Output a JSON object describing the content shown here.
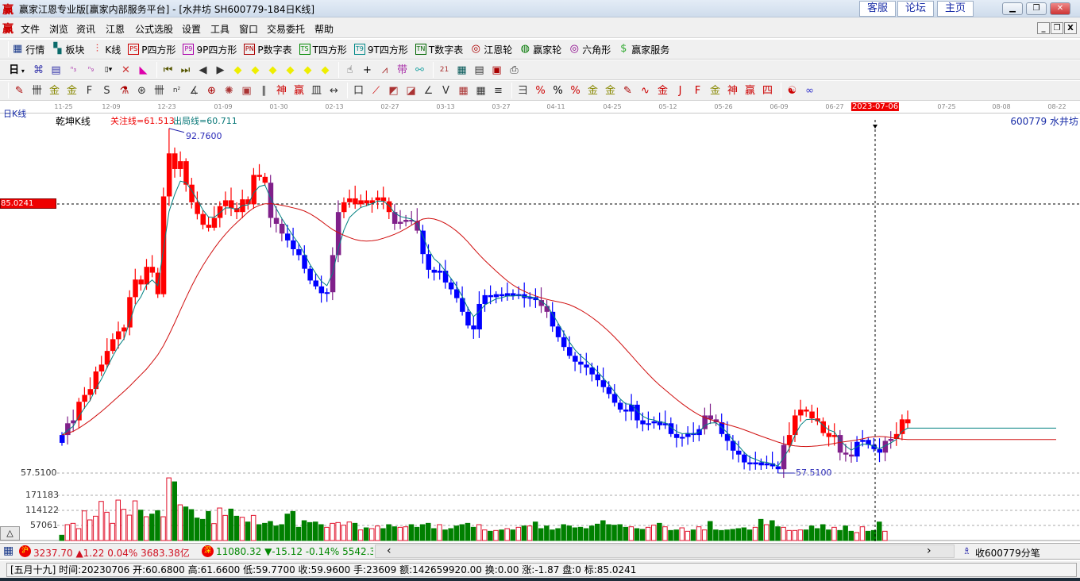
{
  "titlebar": {
    "title": "赢家江恩专业版[赢家内部服务平台] - [水井坊  SH600779-184日K线]",
    "links": [
      "客服",
      "论坛",
      "主页"
    ]
  },
  "menu": [
    "文件",
    "浏览",
    "资讯",
    "江恩",
    "公式选股",
    "设置",
    "工具",
    "窗口",
    "交易委托",
    "帮助"
  ],
  "toolbar1": [
    {
      "label": "行情",
      "icon": "grid-table-icon",
      "glyph": "▦",
      "color": "#1a3a8a"
    },
    {
      "label": "板块",
      "icon": "sector-blocks-icon",
      "glyph": "▚",
      "color": "#0a6a6a"
    },
    {
      "label": "K线",
      "icon": "candlestick-icon",
      "glyph": "⫶",
      "color": "#d00"
    },
    {
      "label": "P四方形",
      "icon": "ps-icon",
      "glyph": "PS",
      "color": "#c00"
    },
    {
      "label": "9P四方形",
      "icon": "p9-icon",
      "glyph": "P9",
      "color": "#a0a"
    },
    {
      "label": "P数字表",
      "icon": "pn-icon",
      "glyph": "PN",
      "color": "#a00"
    },
    {
      "label": "T四方形",
      "icon": "ts-icon",
      "glyph": "TS",
      "color": "#080"
    },
    {
      "label": "9T四方形",
      "icon": "t9-icon",
      "glyph": "T9",
      "color": "#088"
    },
    {
      "label": "T数字表",
      "icon": "tn-icon",
      "glyph": "TN",
      "color": "#060"
    },
    {
      "label": "江恩轮",
      "icon": "gann-wheel-icon",
      "glyph": "◎",
      "color": "#a00"
    },
    {
      "label": "赢家轮",
      "icon": "winner-wheel-icon",
      "glyph": "◍",
      "color": "#070"
    },
    {
      "label": "六角形",
      "icon": "hexagon-icon",
      "glyph": "◎",
      "color": "#808"
    },
    {
      "label": "赢家服务",
      "icon": "dollar-icon",
      "glyph": "$",
      "color": "#3a3"
    }
  ],
  "toolbar2": {
    "period": "日",
    "icons": [
      {
        "name": "cycle-icon",
        "glyph": "⌘",
        "color": "#33a"
      },
      {
        "name": "notes-icon",
        "glyph": "▤",
        "color": "#33a"
      },
      {
        "name": "indicator3-icon",
        "glyph": "ⁿ₃",
        "color": "#a3a"
      },
      {
        "name": "indicator9-icon",
        "glyph": "ⁿ₉",
        "color": "#a3a"
      },
      {
        "name": "candle-type-icon",
        "glyph": "▯▾",
        "color": "#000"
      },
      {
        "name": "restore-icon",
        "glyph": "✕",
        "color": "#c33"
      },
      {
        "name": "gradient-icon",
        "glyph": "◣",
        "color": "#d0a"
      },
      {
        "sep": true
      },
      {
        "name": "first-icon",
        "glyph": "⏮",
        "color": "#550"
      },
      {
        "name": "last-icon",
        "glyph": "⏭",
        "color": "#550"
      },
      {
        "name": "prev-icon",
        "glyph": "◀",
        "color": "#333"
      },
      {
        "name": "next-icon",
        "glyph": "▶",
        "color": "#333"
      },
      {
        "name": "left-arrow-diamond-icon",
        "glyph": "◆",
        "color": "#ee0"
      },
      {
        "name": "right-arrow-diamond-icon",
        "glyph": "◆",
        "color": "#ee0"
      },
      {
        "name": "expand-diamond-icon",
        "glyph": "◆",
        "color": "#ee0"
      },
      {
        "name": "shrink-diamond-icon",
        "glyph": "◆",
        "color": "#ee0"
      },
      {
        "name": "vexpand-diamond-icon",
        "glyph": "◆",
        "color": "#ee0"
      },
      {
        "name": "all-diamond-icon",
        "glyph": "◆",
        "color": "#ee0"
      },
      {
        "sep": true
      },
      {
        "name": "hand-icon",
        "glyph": "☝",
        "color": "#333"
      },
      {
        "name": "crosshair-icon",
        "glyph": "+",
        "color": "#000"
      },
      {
        "name": "zigzag-icon",
        "glyph": "⩘",
        "color": "#a33"
      },
      {
        "name": "pattern-icon",
        "glyph": "带",
        "color": "#a3a"
      },
      {
        "name": "chain-icon",
        "glyph": "⚯",
        "color": "#3aa"
      },
      {
        "sep": true
      },
      {
        "name": "calendar-icon",
        "glyph": "21",
        "color": "#a33"
      },
      {
        "name": "calculator-icon",
        "glyph": "▦",
        "color": "#055"
      },
      {
        "name": "report-icon",
        "glyph": "▤",
        "color": "#333"
      },
      {
        "name": "save-icon",
        "glyph": "▣",
        "color": "#a00"
      },
      {
        "name": "print-icon",
        "glyph": "⎙",
        "color": "#333"
      }
    ]
  },
  "toolbar3": [
    {
      "name": "pen-icon",
      "glyph": "✎",
      "color": "#a00"
    },
    {
      "name": "vlines-icon",
      "glyph": "卌",
      "color": "#333"
    },
    {
      "name": "gold-line-icon",
      "glyph": "金",
      "color": "#880"
    },
    {
      "name": "gold-line2-icon",
      "glyph": "金",
      "color": "#880"
    },
    {
      "name": "f-lines-icon",
      "glyph": "F",
      "color": "#333"
    },
    {
      "name": "spiral-icon",
      "glyph": "S",
      "color": "#333"
    },
    {
      "name": "rocket-icon",
      "glyph": "⚗",
      "color": "#a00"
    },
    {
      "name": "circle-ruler-icon",
      "glyph": "⊛",
      "color": "#333"
    },
    {
      "name": "period-lines-icon",
      "glyph": "卌",
      "color": "#333"
    },
    {
      "name": "n2-icon",
      "glyph": "n²",
      "color": "#333"
    },
    {
      "name": "angle-icon",
      "glyph": "∡",
      "color": "#333"
    },
    {
      "name": "target-icon",
      "glyph": "⊕",
      "color": "#a00"
    },
    {
      "name": "gann-star-icon",
      "glyph": "✺",
      "color": "#a33"
    },
    {
      "name": "square-target-icon",
      "glyph": "▣",
      "color": "#a33"
    },
    {
      "name": "parallel-icon",
      "glyph": "∥",
      "color": "#333"
    },
    {
      "name": "shen-icon",
      "glyph": "神",
      "color": "#c00"
    },
    {
      "name": "ying-icon",
      "glyph": "赢",
      "color": "#c00"
    },
    {
      "name": "comb-icon",
      "glyph": "皿",
      "color": "#333"
    },
    {
      "name": "width-icon",
      "glyph": "↔",
      "color": "#333"
    },
    {
      "sep": true
    },
    {
      "name": "box-icon",
      "glyph": "口",
      "color": "#333"
    },
    {
      "name": "fan-icon",
      "glyph": "⟋",
      "color": "#c00"
    },
    {
      "name": "arc-fan-icon",
      "glyph": "◩",
      "color": "#a33"
    },
    {
      "name": "box-fan-icon",
      "glyph": "◪",
      "color": "#a33"
    },
    {
      "name": "angle-fan-icon",
      "glyph": "∠",
      "color": "#333"
    },
    {
      "name": "v-icon",
      "glyph": "V",
      "color": "#333"
    },
    {
      "name": "grid-icon",
      "glyph": "▦",
      "color": "#a33"
    },
    {
      "name": "grid2-icon",
      "glyph": "▦",
      "color": "#333"
    },
    {
      "name": "slash-lines-icon",
      "glyph": "≡",
      "color": "#333"
    },
    {
      "sep": true
    },
    {
      "name": "ruler-icon",
      "glyph": "彐",
      "color": "#333"
    },
    {
      "name": "pct-line-icon",
      "glyph": "%",
      "color": "#c00"
    },
    {
      "name": "percent-icon",
      "glyph": "%",
      "color": "#000"
    },
    {
      "name": "pct-lines-icon",
      "glyph": "%",
      "color": "#c00"
    },
    {
      "name": "gold-circle-icon",
      "glyph": "金",
      "color": "#880"
    },
    {
      "name": "gold-lines-icon",
      "glyph": "金",
      "color": "#880"
    },
    {
      "name": "pen-lines-icon",
      "glyph": "✎",
      "color": "#a00"
    },
    {
      "name": "wave-icon",
      "glyph": "∿",
      "color": "#c00"
    },
    {
      "name": "gold-box-icon",
      "glyph": "金",
      "color": "#c00"
    },
    {
      "name": "j-fan-icon",
      "glyph": "J",
      "color": "#c00"
    },
    {
      "name": "f-fan-icon",
      "glyph": "F",
      "color": "#c00"
    },
    {
      "name": "gold-fan-icon",
      "glyph": "金",
      "color": "#880"
    },
    {
      "name": "shen-fan-icon",
      "glyph": "神",
      "color": "#c00"
    },
    {
      "name": "ying-fan-icon",
      "glyph": "赢",
      "color": "#c00"
    },
    {
      "name": "four-fan-icon",
      "glyph": "四",
      "color": "#c00"
    },
    {
      "sep": true
    },
    {
      "name": "taiji-icon",
      "glyph": "☯",
      "color": "#c00"
    },
    {
      "name": "infinity-icon",
      "glyph": "∞",
      "color": "#33c"
    }
  ],
  "chart_header": {
    "period_label": "日K线",
    "indicator": "乾坤K线",
    "focus_line": "关注线=61.513",
    "exit_line": "出局线=60.711",
    "symbol": "600779  水井坊",
    "high_label": "92.7600",
    "low_label": "-57.5100",
    "left_low": "57.5100",
    "cursor_price": "85.0241"
  },
  "date_ticks": [
    "11-25",
    "12-09",
    "12-23",
    "01-09",
    "01-30",
    "02-13",
    "02-27",
    "03-13",
    "03-27",
    "04-11",
    "04-25",
    "05-12",
    "05-26",
    "06-09",
    "06-27",
    "2023-07-06",
    "07-25",
    "08-08",
    "08-22"
  ],
  "colors": {
    "red": "#ff0000",
    "blue": "#0000ff",
    "purple": "#80208a",
    "ma_short": "#008080",
    "ma_long": "#d01010",
    "vol_up": "#e0102a",
    "vol_down": "#008000"
  },
  "chart_data": {
    "type": "candlestick",
    "ylim": [
      57.51,
      92.76
    ],
    "highest": 92.76,
    "lowest": 57.51,
    "close": [
      61.4,
      62.6,
      62.9,
      64.8,
      65.5,
      66.1,
      67.9,
      68.6,
      70.0,
      71.2,
      72.0,
      72.4,
      75.5,
      77.3,
      76.8,
      78.6,
      78.0,
      75.8,
      85.8,
      90.2,
      88.6,
      89.4,
      87.0,
      85.2,
      84.0,
      82.9,
      82.6,
      83.6,
      84.8,
      85.4,
      84.6,
      84.2,
      85.5,
      85.0,
      88.0,
      87.8,
      87.2,
      83.6,
      83.0,
      82.0,
      81.3,
      80.4,
      79.8,
      78.4,
      77.2,
      76.6,
      75.9,
      76.0,
      79.8,
      84.2,
      85.2,
      85.6,
      85.0,
      85.4,
      85.1,
      85.4,
      85.7,
      85.3,
      84.2,
      83.0,
      83.2,
      83.4,
      83.3,
      82.3,
      79.9,
      78.3,
      78.0,
      78.2,
      77.0,
      76.3,
      75.4,
      74.0,
      72.6,
      72.2,
      74.8,
      75.7,
      75.5,
      75.8,
      75.6,
      75.9,
      75.6,
      75.8,
      75.4,
      75.5,
      75.2,
      74.6,
      74.0,
      72.5,
      71.4,
      70.4,
      69.5,
      68.9,
      68.6,
      68.3,
      67.6,
      67.0,
      66.3,
      65.6,
      64.7,
      64.0,
      63.8,
      64.5,
      62.9,
      62.5,
      62.6,
      62.8,
      62.4,
      62.6,
      61.5,
      61.1,
      61.2,
      61.6,
      61.4,
      62.0,
      63.4,
      63.0,
      62.7,
      61.5,
      60.8,
      59.8,
      59.4,
      58.6,
      58.4,
      58.6,
      58.3,
      58.5,
      58.2,
      57.9,
      60.4,
      61.4,
      63.4,
      64.0,
      63.8,
      63.1,
      62.8,
      61.6,
      61.2,
      61.4,
      59.6,
      59.4,
      59.2,
      60.7,
      60.9,
      60.4,
      59.96,
      59.6,
      60.8,
      61.0,
      61.5,
      63.0,
      62.6
    ],
    "trend_segments": [
      [
        0,
        0,
        "blue"
      ],
      [
        1,
        2,
        "purple"
      ],
      [
        3,
        36,
        "red"
      ],
      [
        37,
        39,
        "purple"
      ],
      [
        40,
        47,
        "blue"
      ],
      [
        48,
        49,
        "purple"
      ],
      [
        50,
        58,
        "red"
      ],
      [
        59,
        63,
        "purple"
      ],
      [
        64,
        84,
        "blue"
      ],
      [
        85,
        86,
        "purple"
      ],
      [
        87,
        113,
        "blue"
      ],
      [
        114,
        116,
        "purple"
      ],
      [
        117,
        127,
        "blue"
      ],
      [
        128,
        128,
        "purple"
      ],
      [
        129,
        137,
        "red"
      ],
      [
        138,
        140,
        "purple"
      ],
      [
        141,
        145,
        "blue"
      ],
      [
        146,
        147,
        "purple"
      ],
      [
        148,
        150,
        "red"
      ]
    ],
    "volume": [
      20000,
      60000,
      65000,
      45000,
      112000,
      78000,
      92000,
      148000,
      107000,
      65000,
      153000,
      118000,
      96000,
      150000,
      115000,
      90000,
      100000,
      113000,
      90000,
      237000,
      222000,
      135000,
      127000,
      117000,
      85000,
      80000,
      110000,
      64000,
      123000,
      95000,
      119000,
      92000,
      88000,
      70000,
      95000,
      60000,
      65000,
      72000,
      55000,
      60000,
      100000,
      110000,
      50000,
      75000,
      68000,
      70000,
      60000,
      50000,
      65000,
      68000,
      58000,
      70000,
      65000,
      40000,
      48000,
      45000,
      55000,
      45000,
      60000,
      52000,
      50000,
      52000,
      60000,
      50000,
      60000,
      65000,
      45000,
      60000,
      40000,
      45000,
      55000,
      60000,
      65000,
      50000,
      60000,
      40000,
      35000,
      38000,
      40000,
      45000,
      40000,
      50000,
      55000,
      55000,
      70000,
      45000,
      55000,
      40000,
      45000,
      60000,
      55000,
      48000,
      50000,
      45000,
      55000,
      62000,
      75000,
      60000,
      58000,
      60000,
      50000,
      52000,
      45000,
      42000,
      50000,
      58000,
      65000,
      52000,
      38000,
      40000,
      48000,
      35000,
      40000,
      52000,
      40000,
      72000,
      40000,
      38000,
      40000,
      42000,
      45000,
      48000,
      40000,
      50000,
      80000,
      60000,
      75000,
      52000,
      50000,
      38000,
      38000,
      40000,
      40000,
      55000,
      45000,
      60000,
      40000,
      50000,
      38000,
      55000,
      35000,
      30000,
      52000,
      35000,
      38000,
      70000,
      35000
    ],
    "volume_axis": [
      "171183",
      "114122",
      "57061"
    ]
  },
  "indexbar": {
    "sh_badge": "沪",
    "sh": "3237.70 ▲1.22 0.04% 3683.38亿",
    "sz_badge": "深",
    "sz": "11080.32 ▼-15.12 -0.14% 5542.38",
    "scroll_left": "‹",
    "scroll_right": "›",
    "tick_label": "收600779分笔"
  },
  "status": "[五月十九] 时间:20230706 开:60.6800 高:61.6600 低:59.7700 收:59.9600 手:23609 额:142659920.00 换:0.00 涨:-1.87 盘:0 标:85.0241",
  "volume_toggle": "△"
}
